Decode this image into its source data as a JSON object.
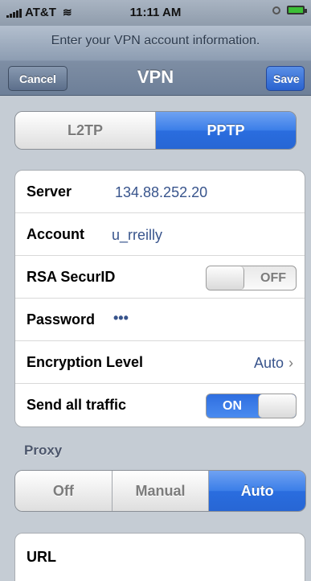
{
  "status_bar": {
    "carrier": "AT&T",
    "time": "11:11 AM"
  },
  "nav": {
    "prompt": "Enter your VPN account information.",
    "title": "VPN",
    "cancel_label": "Cancel",
    "save_label": "Save"
  },
  "protocol": {
    "options": [
      "L2TP",
      "PPTP"
    ],
    "selected": "PPTP"
  },
  "settings": {
    "server": {
      "label": "Server",
      "value": "134.88.252.20"
    },
    "account": {
      "label": "Account",
      "value": "u_rreilly"
    },
    "rsa": {
      "label": "RSA SecurID",
      "state": "OFF"
    },
    "password": {
      "label": "Password",
      "value": "•••"
    },
    "encryption": {
      "label": "Encryption Level",
      "value": "Auto"
    },
    "send_all": {
      "label": "Send all traffic",
      "state": "ON"
    }
  },
  "proxy": {
    "header": "Proxy",
    "options": [
      "Off",
      "Manual",
      "Auto"
    ],
    "selected": "Auto"
  },
  "url": {
    "label": "URL"
  },
  "colors": {
    "accent": "#2a6ddf",
    "background": "#c5ccd4",
    "value_text": "#38548c"
  }
}
